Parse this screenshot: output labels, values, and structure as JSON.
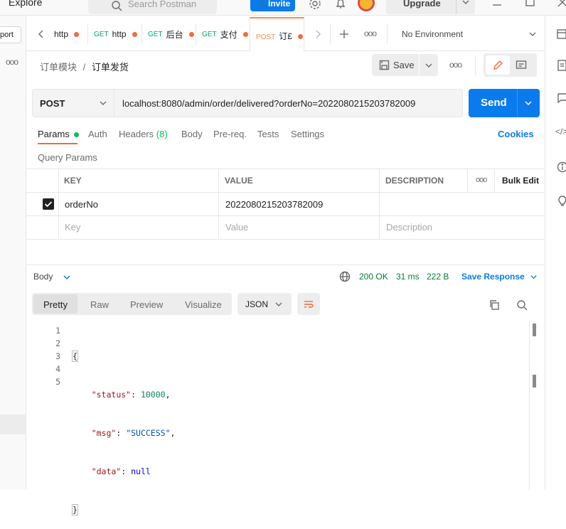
{
  "topbar": {
    "explore": "Explore",
    "search_placeholder": "Search Postman",
    "invite": "Invite",
    "upgrade": "Upgrade"
  },
  "left_sidebar": {
    "import_label": "port"
  },
  "tabs": [
    {
      "method": "",
      "name": "http"
    },
    {
      "method": "GET",
      "name": "http"
    },
    {
      "method": "GET",
      "name": "后台"
    },
    {
      "method": "GET",
      "name": "支付"
    },
    {
      "method": "POST",
      "name": "订£"
    }
  ],
  "environment": "No Environment",
  "breadcrumb": {
    "parent": "订单模块",
    "separator": "/",
    "current": "订单发货"
  },
  "toolbar": {
    "save_label": "Save"
  },
  "request": {
    "method": "POST",
    "url": "localhost:8080/admin/order/delivered?orderNo=2022080215203782009",
    "send_label": "Send"
  },
  "request_tabs": {
    "params": "Params",
    "auth": "Auth",
    "headers": "Headers",
    "headers_count": "(8)",
    "body": "Body",
    "prereq": "Pre-req.",
    "tests": "Tests",
    "settings": "Settings",
    "cookies": "Cookies"
  },
  "query_params": {
    "title": "Query Params",
    "col_key": "KEY",
    "col_value": "VALUE",
    "col_description": "DESCRIPTION",
    "bulk_edit": "Bulk Edit",
    "row_key": "orderNo",
    "row_value": "2022080215203782009",
    "placeholder_key": "Key",
    "placeholder_value": "Value",
    "placeholder_description": "Description"
  },
  "response": {
    "body_label": "Body",
    "status": "200 OK",
    "time": "31 ms",
    "size": "222 B",
    "save_response": "Save Response",
    "view_tabs": [
      "Pretty",
      "Raw",
      "Preview",
      "Visualize"
    ],
    "format": "JSON",
    "line_numbers": [
      "1",
      "2",
      "3",
      "4",
      "5"
    ],
    "open_brace": "{",
    "close_brace": "}",
    "status_key": "\"status\"",
    "status_value": "10000",
    "msg_key": "\"msg\"",
    "msg_value": "\"SUCCESS\"",
    "data_key": "\"data\"",
    "data_value": "null"
  },
  "colors": {
    "accent_blue": "#097bed",
    "method_post": "#f6904b",
    "method_get": "#00a86b",
    "status_green": "#007f31",
    "string_red": "#a31515",
    "number_green": "#098658",
    "keyword_blue": "#0000ff"
  }
}
